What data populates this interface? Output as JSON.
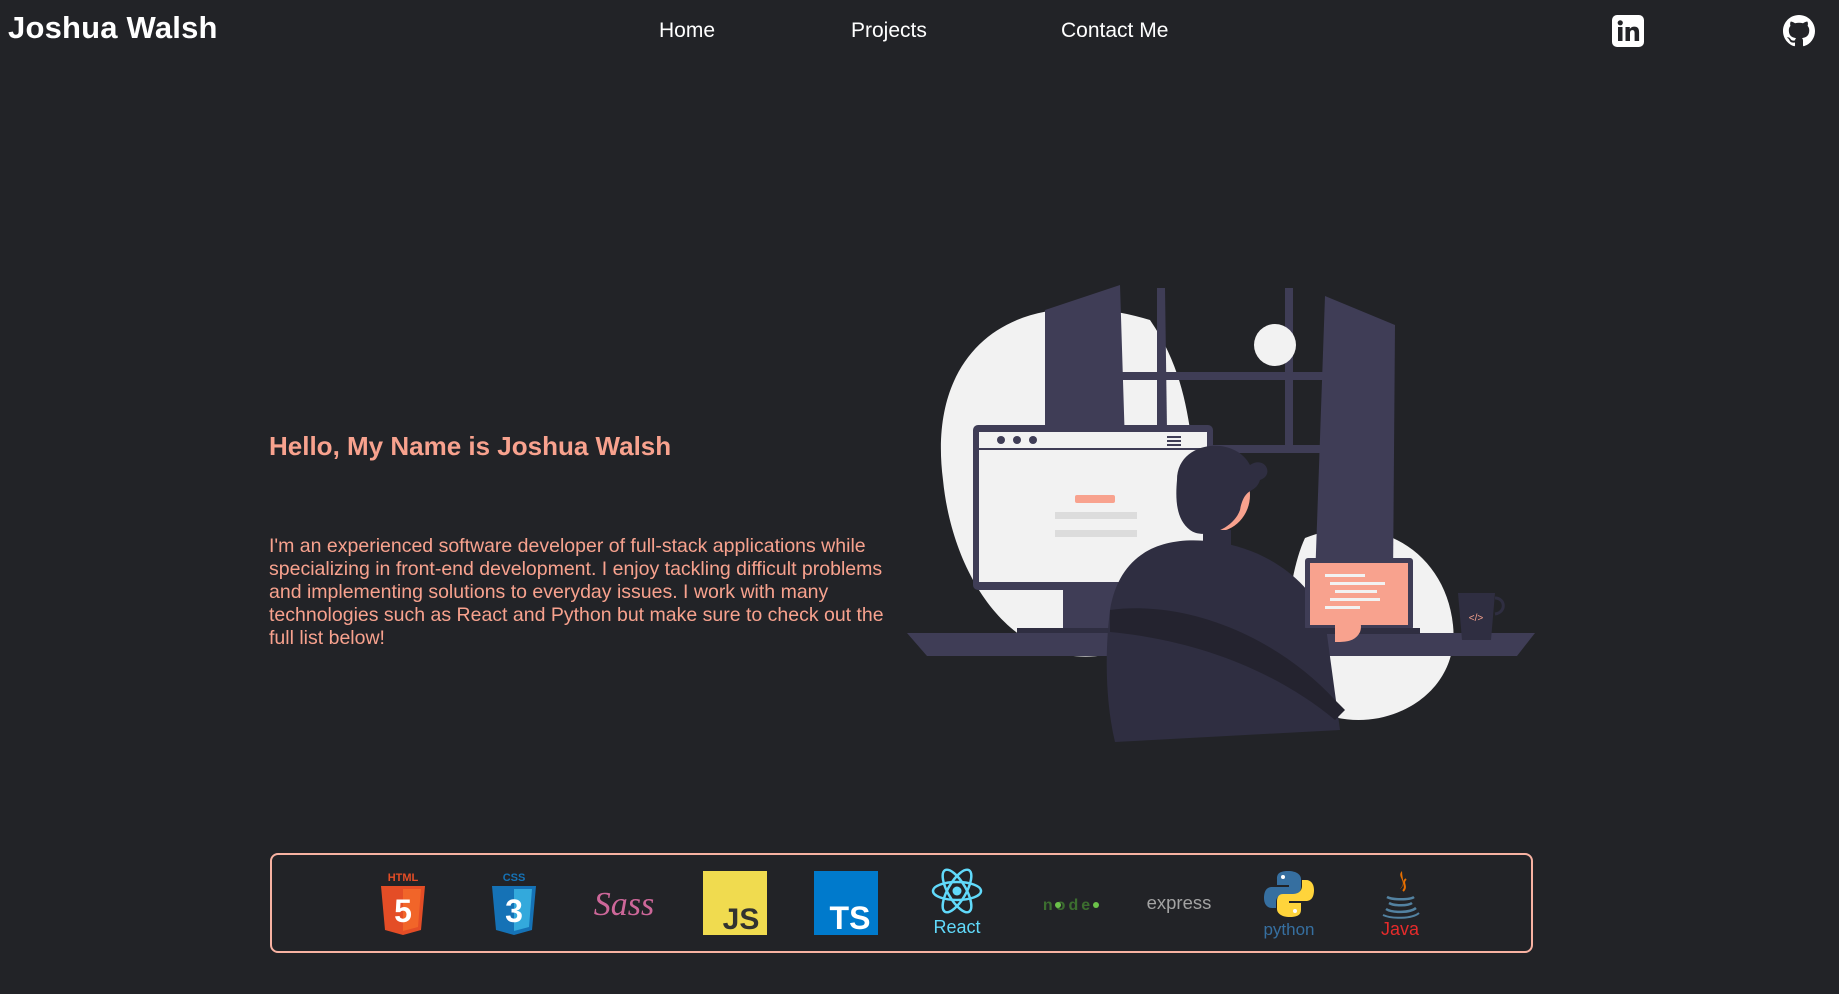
{
  "header": {
    "brand": "Joshua Walsh",
    "nav": [
      {
        "label": "Home"
      },
      {
        "label": "Projects"
      },
      {
        "label": "Contact Me"
      }
    ],
    "social": [
      {
        "icon": "linkedin-icon"
      },
      {
        "icon": "github-icon"
      }
    ]
  },
  "hero": {
    "greeting": "Hello, My Name is Joshua Walsh",
    "intro": "I'm an experienced software developer of full-stack applications while specializing in front-end development. I enjoy tackling difficult problems and implementing solutions to everyday issues. I work with many technologies such as React and Python but make sure to check out the full list below!",
    "illustration_icon": "developer-at-desk-illustration",
    "mug_text": "</>"
  },
  "tech": [
    {
      "icon": "html5-icon",
      "label": "HTML",
      "glyph": "5"
    },
    {
      "icon": "css3-icon",
      "label": "CSS",
      "glyph": "3"
    },
    {
      "icon": "sass-icon",
      "label": "Sass"
    },
    {
      "icon": "javascript-icon",
      "label": "JS"
    },
    {
      "icon": "typescript-icon",
      "label": "TS"
    },
    {
      "icon": "react-icon",
      "label": "React"
    },
    {
      "icon": "nodejs-icon",
      "label": "node"
    },
    {
      "icon": "express-icon",
      "label": "express"
    },
    {
      "icon": "python-icon",
      "label": "python"
    },
    {
      "icon": "java-icon",
      "label": "Java"
    }
  ],
  "colors": {
    "background": "#222327",
    "accent": "#f8a28e",
    "border": "#f8b2a2",
    "illustration_dark": "#3f3d56",
    "illustration_light": "#f2f2f2"
  }
}
